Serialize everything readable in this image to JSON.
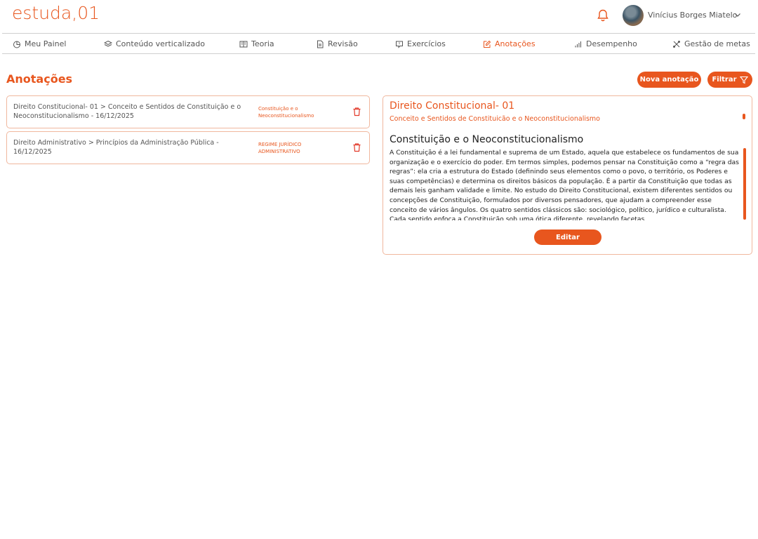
{
  "header": {
    "logo": "estuda,01",
    "user_name": "Vinícius Borges Miatelo"
  },
  "nav": {
    "items": [
      {
        "label": "Meu Painel",
        "icon": "chart-pie-icon",
        "active": false
      },
      {
        "label": "Conteúdo verticalizado",
        "icon": "layers-icon",
        "active": false
      },
      {
        "label": "Teoria",
        "icon": "book-icon",
        "active": false
      },
      {
        "label": "Revisão",
        "icon": "document-icon",
        "active": false
      },
      {
        "label": "Exercícios",
        "icon": "chat-question-icon",
        "active": false
      },
      {
        "label": "Anotações",
        "icon": "edit-icon",
        "active": true
      },
      {
        "label": "Desempenho",
        "icon": "bar-chart-icon",
        "active": false
      },
      {
        "label": "Gestão de metas",
        "icon": "tools-icon",
        "active": false
      }
    ]
  },
  "page": {
    "title": "Anotações",
    "new_button": "Nova anotação",
    "filter_button": "Filtrar"
  },
  "notes": [
    {
      "path": "Direito Constitucional- 01 > Conceito e Sentidos de Constituição e o Neoconstitucionalismo - 16/12/2025",
      "tag": "Constituição e o Neoconstitucionalismo"
    },
    {
      "path": "Direito Administrativo > Princípios da Administração Pública - 16/12/2025",
      "tag": "REGIME JURÍDICO ADMINISTRATIVO"
    }
  ],
  "detail": {
    "title": "Direito Constitucional- 01",
    "subtitle": "Conceito e Sentidos de Constituição e o Neoconstitucionalismo",
    "heading": "Constituição e o Neoconstitucionalismo",
    "body": "A Constituição é a lei fundamental e suprema de um Estado, aquela que estabelece os fundamentos de sua organização e o exercício do poder. Em termos simples, podemos pensar na Constituição como a “regra das regras”: ela cria a estrutura do Estado (definindo seus elementos como o povo, o território, os Poderes e suas competências) e determina os direitos básicos da população. É a partir da Constituição que todas as demais leis ganham validade e limite. No estudo do Direito Constitucional, existem diferentes sentidos ou concepções de Constituição, formulados por diversos pensadores, que ajudam a compreender esse conceito de vários ângulos. Os quatro sentidos clássicos são: sociológico, político, jurídico e culturalista. Cada sentido enfoca a Constituição sob uma ótica diferente, revelando facetas",
    "edit_button": "Editar"
  },
  "colors": {
    "accent": "#e8561e",
    "border": "#f0b79e"
  }
}
